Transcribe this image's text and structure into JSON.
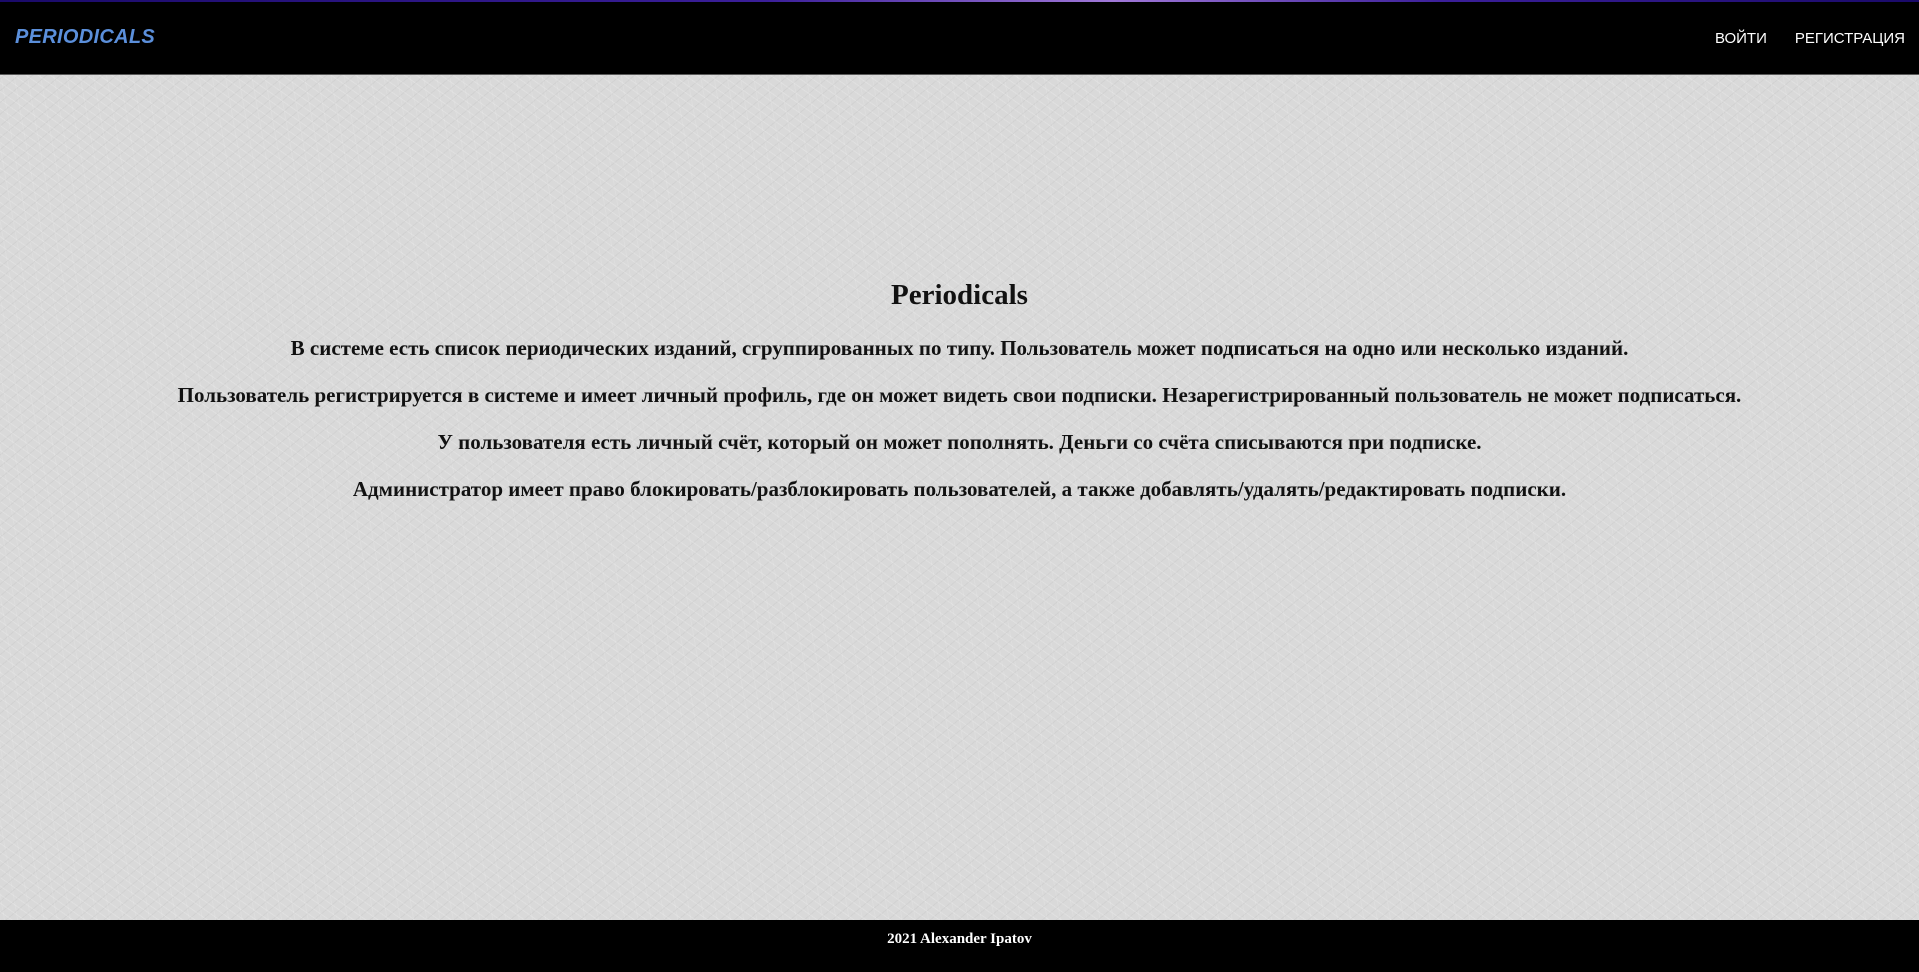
{
  "header": {
    "brand": "PERIODICALS",
    "nav": {
      "login": "ВОЙТИ",
      "register": "РЕГИСТРАЦИЯ"
    }
  },
  "main": {
    "title": "Periodicals",
    "paragraphs": [
      "В системе есть список периодических изданий, сгруппированных по типу. Пользователь может подписаться на одно или несколько изданий.",
      "Пользователь регистрируется в системе и имеет личный профиль, где он может видеть свои подписки. Незарегистрированный пользователь не может подписаться.",
      "У пользователя есть личный счёт, который он может пополнять. Деньги со счёта списываются при подписке.",
      "Администратор имеет право блокировать/разблокировать пользователей, а также добавлять/удалять/редактировать подписки."
    ]
  },
  "footer": {
    "text": "2021 Alexander Ipatov"
  },
  "colors": {
    "brand": "#5b8fdb",
    "header_bg": "#000000",
    "page_bg": "#d9d9d9",
    "text": "#111111"
  }
}
